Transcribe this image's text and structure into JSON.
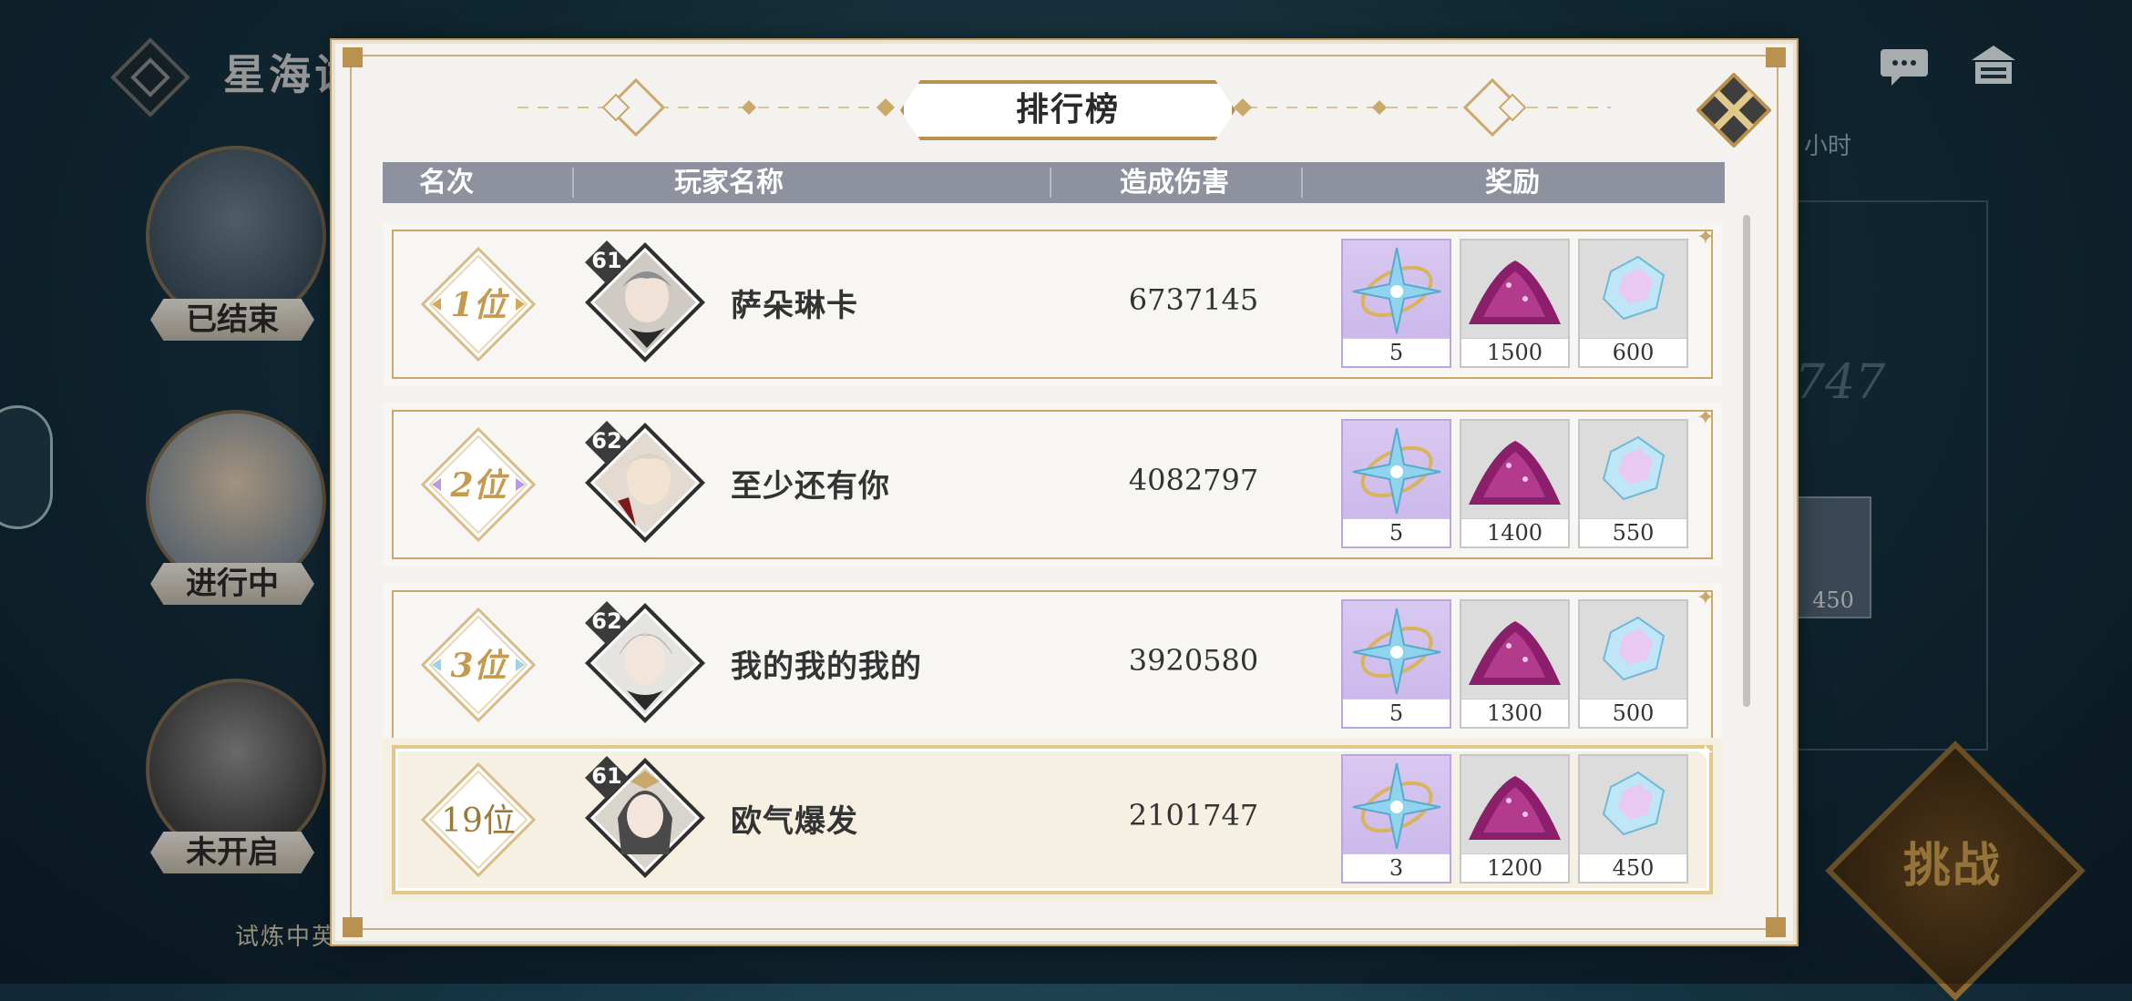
{
  "background": {
    "title": "星海试",
    "stages": [
      {
        "label": "已结束"
      },
      {
        "label": "进行中"
      },
      {
        "label": "未开启"
      }
    ],
    "footer_text": "试炼中英",
    "right_label": "小时",
    "right_number": "747",
    "right_item_qty": "450",
    "challenge_label": "挑战"
  },
  "modal": {
    "title": "排行榜",
    "columns": [
      "名次",
      "玩家名称",
      "造成伤害",
      "奖励"
    ],
    "rows": [
      {
        "rank": "1位",
        "level": "61",
        "name": "萨朵琳卡",
        "damage": "6737145",
        "rewards": [
          "5",
          "1500",
          "600"
        ]
      },
      {
        "rank": "2位",
        "level": "62",
        "name": "至少还有你",
        "damage": "4082797",
        "rewards": [
          "5",
          "1400",
          "550"
        ]
      },
      {
        "rank": "3位",
        "level": "62",
        "name": "我的我的我的",
        "damage": "3920580",
        "rewards": [
          "5",
          "1300",
          "500"
        ]
      }
    ],
    "my_row": {
      "rank": "19位",
      "level": "61",
      "name": "欧气爆发",
      "damage": "2101747",
      "rewards": [
        "3",
        "1200",
        "450"
      ]
    },
    "reward_icons": [
      "star-compass-icon",
      "purple-dust-icon",
      "crystal-icon"
    ]
  },
  "colors": {
    "gold": "#b8924e",
    "header": "#8e929f",
    "panel": "#f3f2ef"
  }
}
